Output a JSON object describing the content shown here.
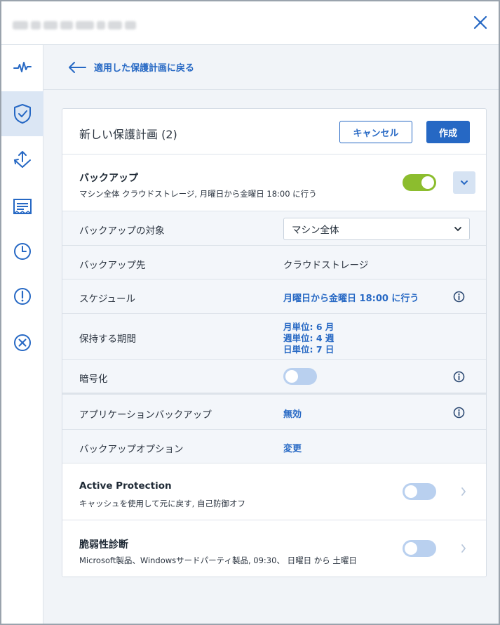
{
  "window": {
    "title_blurred": true,
    "close_label": "Close"
  },
  "rail": {
    "items": [
      {
        "icon": "activity-pulse-icon",
        "active": false
      },
      {
        "icon": "shield-check-icon",
        "active": true
      },
      {
        "icon": "recovery-arrows-icon",
        "active": false
      },
      {
        "icon": "receipt-report-icon",
        "active": false
      },
      {
        "icon": "clock-history-icon",
        "active": false
      },
      {
        "icon": "alert-circle-icon",
        "active": false
      },
      {
        "icon": "x-circle-icon",
        "active": false
      }
    ]
  },
  "back": {
    "label": "適用した保護計画に戻る"
  },
  "plan": {
    "title": "新しい保護計画 (2)",
    "cancel_label": "キャンセル",
    "create_label": "作成"
  },
  "backup": {
    "title": "バックアップ",
    "summary": "マシン全体 クラウドストレージ, 月曜日から金曜日 18:00 に行う",
    "enabled": true
  },
  "rows": {
    "target_label": "バックアップの対象",
    "target_value": "マシン全体",
    "destination_label": "バックアップ先",
    "destination_value": "クラウドストレージ",
    "schedule_label": "スケジュール",
    "schedule_value": "月曜日から金曜日 18:00 に行う",
    "retention_label": "保持する期間",
    "retention_monthly": "月単位: 6 月",
    "retention_weekly": "週単位: 4 週",
    "retention_daily": "日単位: 7 日",
    "encryption_label": "暗号化",
    "encryption_enabled": false,
    "app_backup_label": "アプリケーションバックアップ",
    "app_backup_value": "無効",
    "options_label": "バックアップオプション",
    "options_value": "変更"
  },
  "active_protection": {
    "title": "Active Protection",
    "summary": "キャッシュを使用して元に戻す, 自己防御オフ",
    "enabled": false
  },
  "vulnerability": {
    "title": "脆弱性診断",
    "summary": "Microsoft製品、Windowsサードパーティ製品, 09:30、 日曜日 から 土曜日",
    "enabled": false
  },
  "colors": {
    "accent": "#2668c4",
    "toggle_on": "#8cbd2e",
    "toggle_off": "#b9d0ef"
  }
}
